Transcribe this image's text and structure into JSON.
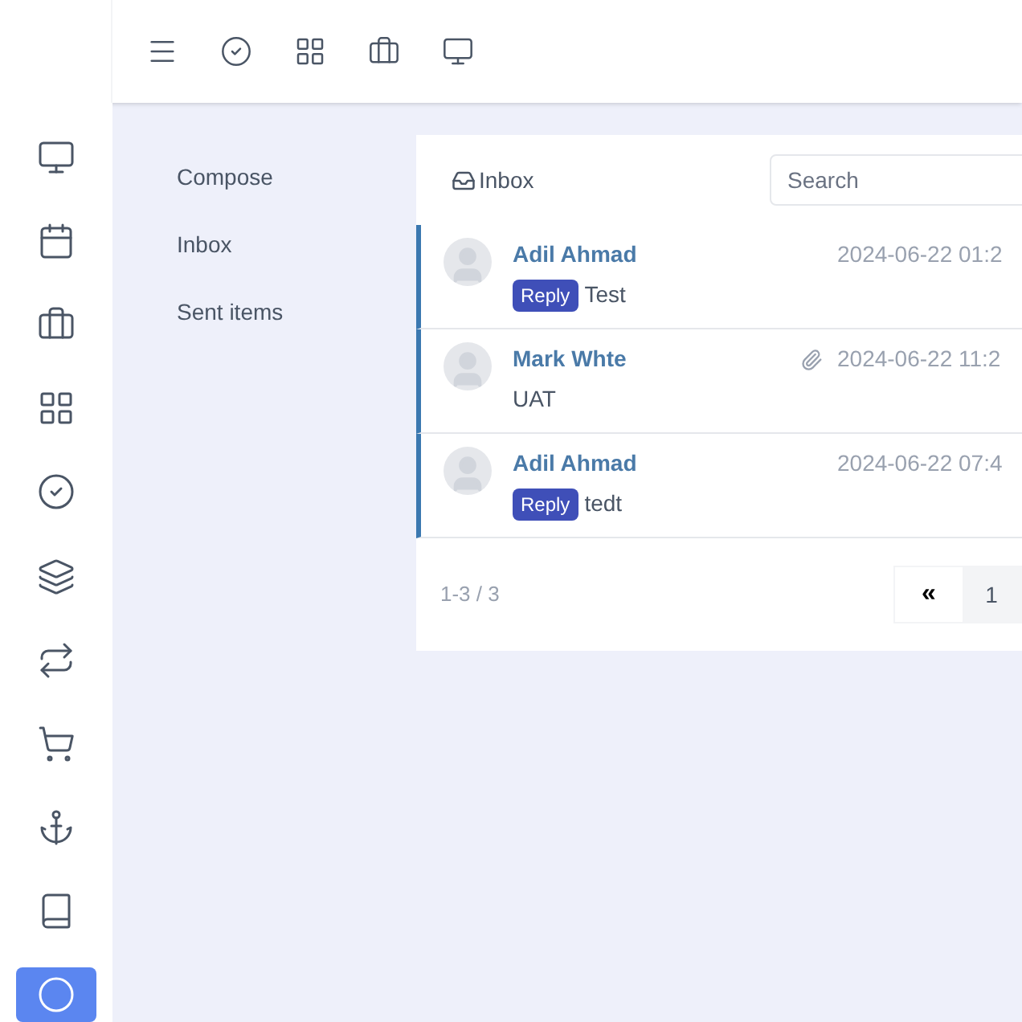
{
  "sidebar": {
    "items": [
      {
        "selected": false
      },
      {
        "selected": false
      },
      {
        "selected": false
      },
      {
        "selected": false
      },
      {
        "selected": false
      },
      {
        "selected": false
      },
      {
        "selected": false
      },
      {
        "selected": false
      },
      {
        "selected": false
      },
      {
        "selected": false
      },
      {
        "selected": true
      }
    ]
  },
  "folders": [
    "Compose",
    "Inbox",
    "Sent items"
  ],
  "mail": {
    "title": "Inbox",
    "search": {
      "placeholder": "Search"
    },
    "messages": [
      {
        "sender": "Adil Ahmad",
        "tag": "Reply",
        "subject": "Test",
        "date": "2024-06-22 01:2",
        "attachment": false
      },
      {
        "sender": "Mark Whte",
        "subject": "UAT",
        "date": "2024-06-22 11:2",
        "attachment": true
      },
      {
        "sender": "Adil Ahmad",
        "tag": "Reply",
        "subject": "tedt",
        "date": "2024-06-22 07:4",
        "attachment": false
      }
    ],
    "pagination": {
      "summary": "1-3 / 3",
      "pages": [
        {
          "label": "«",
          "selected": false
        },
        {
          "label": "1",
          "selected": true
        }
      ]
    }
  }
}
